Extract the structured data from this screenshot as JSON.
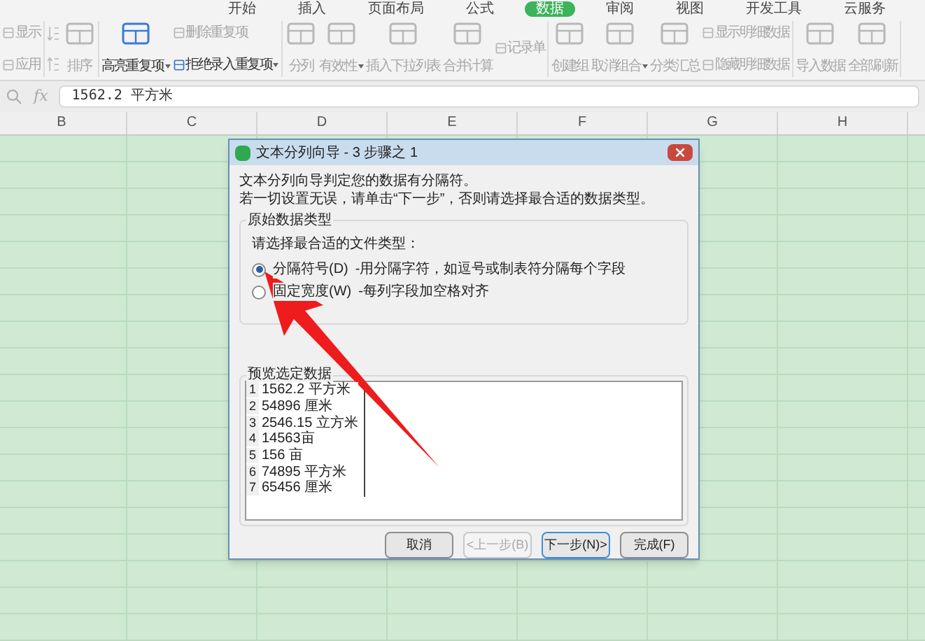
{
  "ribbon": {
    "tabs": [
      {
        "label": "开始",
        "selected": false
      },
      {
        "label": "插入",
        "selected": false
      },
      {
        "label": "页面布局",
        "selected": false
      },
      {
        "label": "公式",
        "selected": false
      },
      {
        "label": "数据",
        "selected": true
      },
      {
        "label": "审阅",
        "selected": false
      },
      {
        "label": "视图",
        "selected": false
      },
      {
        "label": "开发工具",
        "selected": false
      },
      {
        "label": "云服务",
        "selected": false
      }
    ],
    "groups": [
      {
        "tools": [
          {
            "kind": "stack",
            "items": [
              {
                "label": "显示",
                "disabled": true,
                "dropdown": false
              },
              {
                "label": "应用",
                "disabled": true,
                "dropdown": false
              }
            ]
          }
        ]
      },
      {
        "tools": [
          {
            "kind": "sort",
            "label": "排序",
            "disabled": true,
            "dropdown": false
          }
        ]
      },
      {
        "tools": [
          {
            "kind": "large",
            "label": "高亮重复项",
            "disabled": false,
            "dropdown": true
          },
          {
            "kind": "stack",
            "items": [
              {
                "label": "删除重复项",
                "disabled": true,
                "dropdown": false
              },
              {
                "label": "拒绝录入重复项",
                "disabled": false,
                "dropdown": true
              }
            ]
          }
        ]
      },
      {
        "tools": [
          {
            "kind": "large",
            "label": "分列",
            "disabled": true,
            "dropdown": false
          },
          {
            "kind": "large",
            "label": "有效性",
            "disabled": true,
            "dropdown": true
          },
          {
            "kind": "large",
            "label": "插入下拉列表",
            "disabled": true,
            "dropdown": false
          },
          {
            "kind": "large",
            "label": "合并计算",
            "disabled": true,
            "dropdown": false
          },
          {
            "kind": "stack",
            "items": [
              {
                "label": "记录单",
                "disabled": true,
                "dropdown": false
              }
            ]
          }
        ]
      },
      {
        "tools": [
          {
            "kind": "large",
            "label": "创建组",
            "disabled": true,
            "dropdown": false
          },
          {
            "kind": "large",
            "label": "取消组合",
            "disabled": true,
            "dropdown": true
          },
          {
            "kind": "large",
            "label": "分类汇总",
            "disabled": true,
            "dropdown": false
          },
          {
            "kind": "stack",
            "items": [
              {
                "label": "显示明细数据",
                "disabled": true,
                "dropdown": false
              },
              {
                "label": "隐藏明细数据",
                "disabled": true,
                "dropdown": false
              }
            ]
          }
        ]
      },
      {
        "tools": [
          {
            "kind": "large",
            "label": "导入数据",
            "disabled": true,
            "dropdown": false
          },
          {
            "kind": "large",
            "label": "全部刷新",
            "disabled": true,
            "dropdown": false
          }
        ]
      }
    ]
  },
  "formula_bar": {
    "function_label": "fx",
    "value": "1562.2 平方米"
  },
  "sheet": {
    "columns": [
      "B",
      "C",
      "D",
      "E",
      "F",
      "G",
      "H"
    ]
  },
  "dialog": {
    "title": "文本分列向导 - 3 步骤之 1",
    "intro": [
      "文本分列向导判定您的数据有分隔符。",
      "若一切设置无误，请单击“下一步”，否则请选择最合适的数据类型。"
    ],
    "type_group": {
      "legend": "原始数据类型",
      "prompt": "请选择最合适的文件类型：",
      "options": [
        {
          "label": "分隔符号(D)",
          "description": "-用分隔字符，如逗号或制表符分隔每个字段",
          "selected": true
        },
        {
          "label": "固定宽度(W)",
          "description": "-每列字段加空格对齐",
          "selected": false
        }
      ]
    },
    "preview": {
      "legend": "预览选定数据",
      "rows": [
        {
          "number": "1",
          "text": "1562.2 平方米"
        },
        {
          "number": "2",
          "text": "54896 厘米"
        },
        {
          "number": "3",
          "text": "2546.15 立方米"
        },
        {
          "number": "4",
          "text": "14563亩"
        },
        {
          "number": "5",
          "text": "156 亩"
        },
        {
          "number": "6",
          "text": "74895 平方米"
        },
        {
          "number": "7",
          "text": "65456 厘米"
        }
      ]
    },
    "buttons": [
      {
        "label": "取消",
        "disabled": false,
        "focused": false
      },
      {
        "label": "<上一步(B)",
        "disabled": true,
        "focused": false
      },
      {
        "label": "下一步(N)>",
        "disabled": false,
        "focused": true
      },
      {
        "label": "完成(F)",
        "disabled": false,
        "focused": false
      }
    ]
  }
}
